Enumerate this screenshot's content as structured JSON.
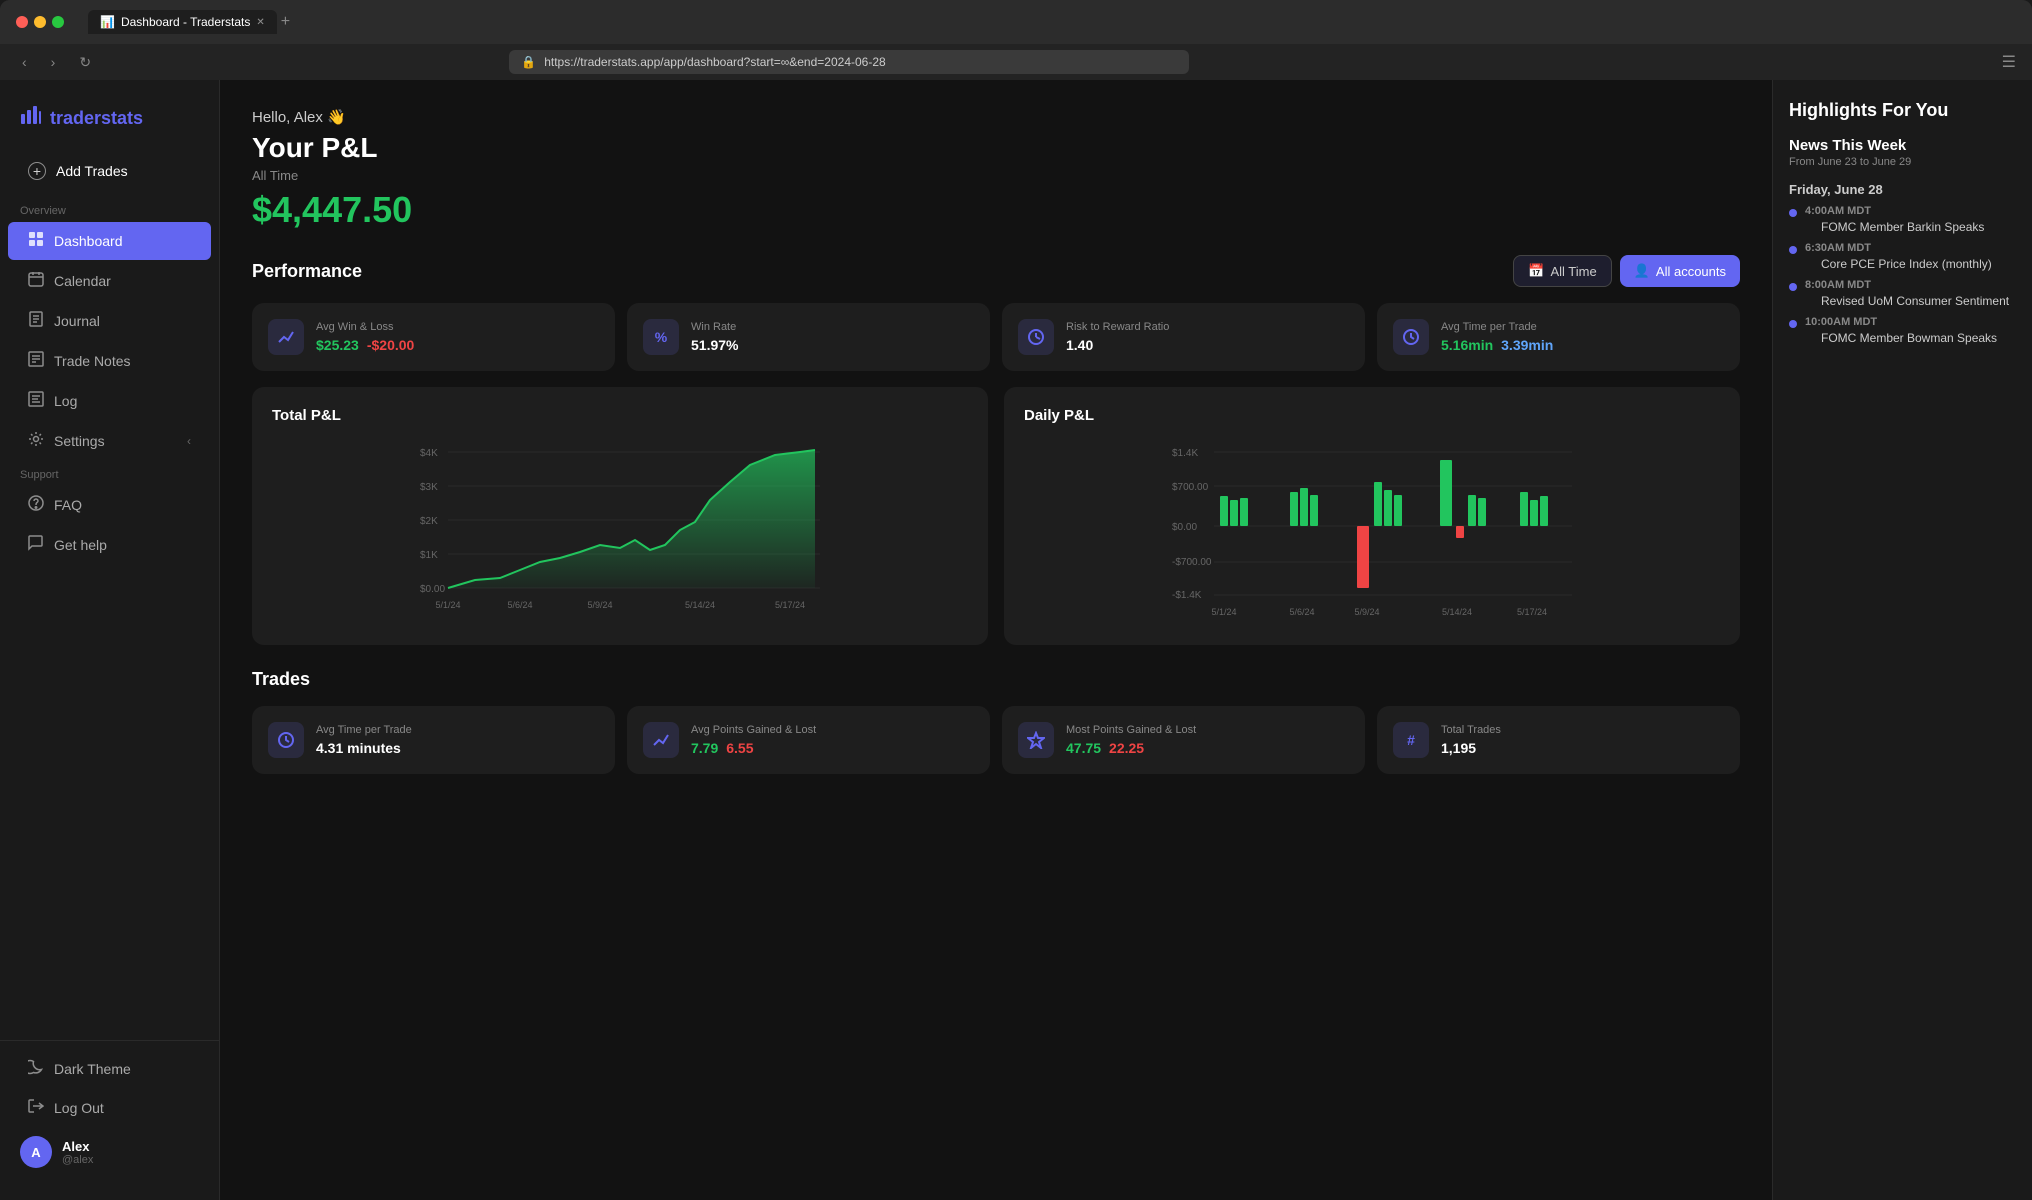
{
  "browser": {
    "url": "https://traderstats.app/app/dashboard?start=∞&end=2024-06-28",
    "tab_title": "Dashboard - Traderstats",
    "favicon": "📊"
  },
  "logo": {
    "text": "traderstats",
    "icon": "📊"
  },
  "sidebar": {
    "add_trades_label": "Add Trades",
    "overview_label": "Overview",
    "nav_items": [
      {
        "id": "dashboard",
        "label": "Dashboard",
        "icon": "▦",
        "active": true
      },
      {
        "id": "calendar",
        "label": "Calendar",
        "icon": "📅"
      },
      {
        "id": "journal",
        "label": "Journal",
        "icon": "📓"
      },
      {
        "id": "trade-notes",
        "label": "Trade Notes",
        "icon": "📋"
      },
      {
        "id": "log",
        "label": "Log",
        "icon": "📑"
      },
      {
        "id": "settings",
        "label": "Settings",
        "icon": "⚙"
      }
    ],
    "support_label": "Support",
    "support_items": [
      {
        "id": "faq",
        "label": "FAQ",
        "icon": "❓"
      },
      {
        "id": "get-help",
        "label": "Get help",
        "icon": "💬"
      }
    ],
    "theme_label": "Dark Theme",
    "logout_label": "Log Out",
    "user": {
      "name": "Alex",
      "handle": "@alex",
      "avatar_initials": "A"
    }
  },
  "main": {
    "greeting": "Hello, Alex 👋",
    "pnl_title": "Your P&L",
    "pnl_period": "All Time",
    "pnl_amount": "$4,447.50",
    "performance_title": "Performance",
    "all_time_btn": "All Time",
    "all_accounts_btn": "All accounts",
    "stat_cards": [
      {
        "label": "Avg Win & Loss",
        "win": "$25.23",
        "loss": "-$20.00",
        "icon": "⇄"
      },
      {
        "label": "Win Rate",
        "value": "51.97%",
        "icon": "%"
      },
      {
        "label": "Risk to Reward Ratio",
        "value": "1.40",
        "icon": "⚡"
      },
      {
        "label": "Avg Time per Trade",
        "win_time": "5.16min",
        "loss_time": "3.39min",
        "icon": "⏱"
      }
    ],
    "total_pnl_title": "Total P&L",
    "daily_pnl_title": "Daily P&L",
    "trades_title": "Trades",
    "trade_stats": [
      {
        "label": "Avg Time per Trade",
        "value": "4.31 minutes",
        "icon": "⏱"
      },
      {
        "label": "Avg Points Gained & Lost",
        "win": "7.79",
        "loss": "6.55",
        "icon": "↗"
      },
      {
        "label": "Most Points Gained & Lost",
        "win": "47.75",
        "loss": "22.25",
        "icon": "⭐"
      },
      {
        "label": "Total Trades",
        "value": "1,195",
        "icon": "#"
      }
    ]
  },
  "highlights": {
    "title": "Highlights For You",
    "news_title": "News This Week",
    "news_date_range": "From June 23 to June 29",
    "days": [
      {
        "day": "Friday, June 28",
        "events": [
          {
            "time": "4:00AM MDT",
            "items": [
              "FOMC Member Barkin Speaks"
            ]
          },
          {
            "time": "6:30AM MDT",
            "items": [
              "Core PCE Price Index (monthly)"
            ]
          },
          {
            "time": "8:00AM MDT",
            "items": [
              "Revised UoM Consumer Sentiment"
            ]
          },
          {
            "time": "10:00AM MDT",
            "items": [
              "FOMC Member Bowman Speaks"
            ]
          }
        ]
      }
    ]
  },
  "charts": {
    "total_pnl": {
      "y_labels": [
        "$4K",
        "$3K",
        "$2K",
        "$1K",
        "$0.00"
      ],
      "x_labels": [
        "5/1/24",
        "5/6/24",
        "5/9/24",
        "5/14/24",
        "5/17/24"
      ]
    },
    "daily_pnl": {
      "y_labels": [
        "$1.4K",
        "$700.00",
        "$0.00",
        "-$700.00",
        "-$1.4K"
      ],
      "x_labels": [
        "5/1/24",
        "5/6/24",
        "5/9/24",
        "5/14/24",
        "5/17/24"
      ]
    }
  }
}
